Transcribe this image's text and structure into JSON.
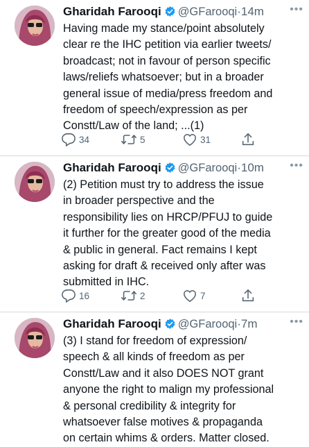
{
  "tweets": [
    {
      "name": "Gharidah Farooqi",
      "handle": "@GFarooqi",
      "separator": "·",
      "time": "14m",
      "text": "Having made my stance/point absolutely\nclear re the IHC petition via earlier tweets/\nbroadcast; not in favour of person specific\nlaws/reliefs whatsoever; but in a broader\ngeneral issue of media/press freedom and\nfreedom of speech/expression as per\nConstt/Law of the land; ...(1)",
      "replies": "34",
      "retweets": "5",
      "likes": "31"
    },
    {
      "name": "Gharidah Farooqi",
      "handle": "@GFarooqi",
      "separator": "·",
      "time": "10m",
      "text": "(2) Petition must try to address the issue\nin broader perspective and the\nresponsibility lies on HRCP/PFUJ to guide\nit further for the greater good of the media\n& public in general. Fact remains I kept\nasking for draft & received only after was\nsubmitted in IHC.",
      "replies": "16",
      "retweets": "2",
      "likes": "7"
    },
    {
      "name": "Gharidah Farooqi",
      "handle": "@GFarooqi",
      "separator": "·",
      "time": "7m",
      "text": "(3) I stand for freedom of expression/\nspeech & all kinds of freedom as per\nConstt/Law and it also DOES NOT grant\nanyone the right to malign my professional\n& personal credibility & integrity for\nwhatsoever false motives & propaganda\non certain whims & orders. Matter closed.",
      "replies": "",
      "retweets": "",
      "likes": ""
    }
  ],
  "more_glyph": "•••",
  "colors": {
    "verified": "#1d9bf0",
    "meta": "#536471",
    "divider": "#d4d9dd"
  },
  "icons": [
    "reply-icon",
    "retweet-icon",
    "like-icon",
    "share-icon",
    "verified-badge-icon",
    "more-options-icon"
  ]
}
